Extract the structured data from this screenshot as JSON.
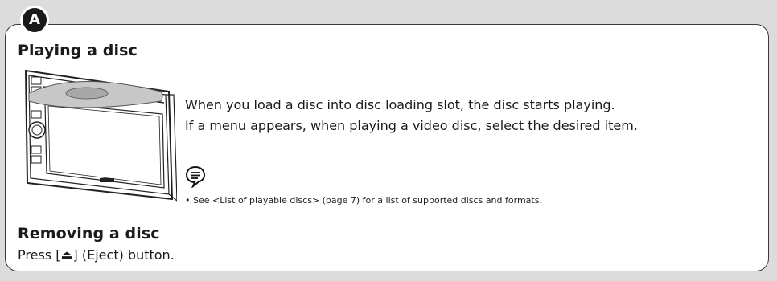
{
  "badge": "A",
  "section_play": {
    "title": "Playing a disc",
    "line1": "When you load a disc into disc loading slot, the disc starts playing.",
    "line2": "If a menu appears, when playing a video disc, select the desired item."
  },
  "note": {
    "icon": "note-speech-bubble-icon",
    "text": "• See <List of playable discs> (page 7) for a list of supported discs and formats."
  },
  "section_remove": {
    "title": "Removing a disc",
    "press": "Press [⏏] (Eject) button."
  }
}
